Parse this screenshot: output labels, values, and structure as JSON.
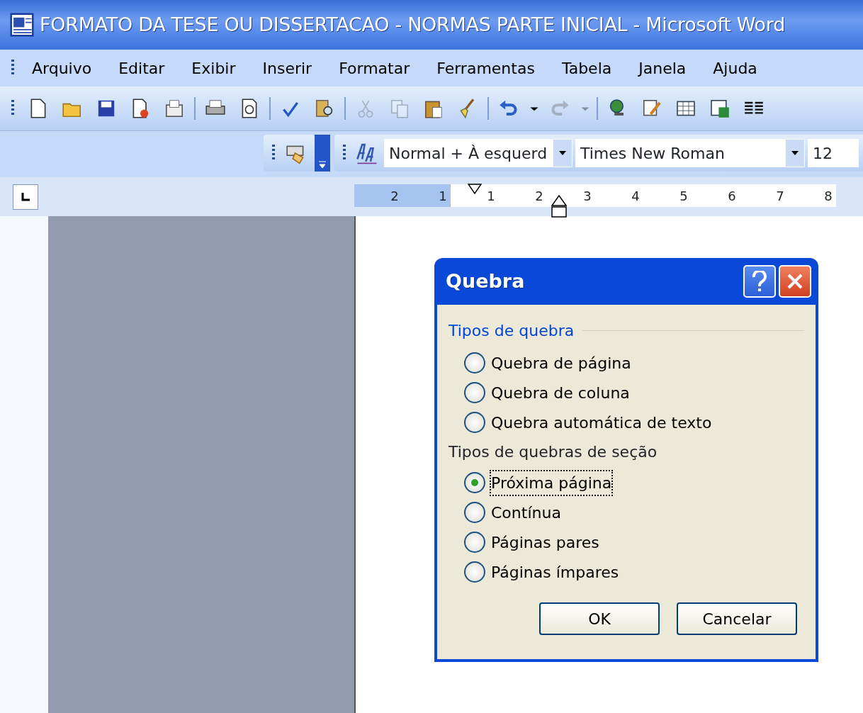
{
  "window": {
    "title": "FORMATO DA TESE OU DISSERTACAO - NORMAS PARTE INICIAL - Microsoft Word"
  },
  "menu": [
    "Arquivo",
    "Editar",
    "Exibir",
    "Inserir",
    "Formatar",
    "Ferramentas",
    "Tabela",
    "Janela",
    "Ajuda"
  ],
  "standard_toolbar": [
    {
      "kind": "new",
      "disabled": false
    },
    {
      "kind": "open",
      "disabled": false
    },
    {
      "kind": "save",
      "disabled": false
    },
    {
      "kind": "permission",
      "disabled": false
    },
    {
      "kind": "email",
      "disabled": false
    },
    {
      "kind": "separator"
    },
    {
      "kind": "print",
      "disabled": false
    },
    {
      "kind": "preview",
      "disabled": false
    },
    {
      "kind": "separator"
    },
    {
      "kind": "spelling",
      "disabled": false
    },
    {
      "kind": "research",
      "disabled": false
    },
    {
      "kind": "separator"
    },
    {
      "kind": "cut",
      "disabled": true
    },
    {
      "kind": "copy",
      "disabled": true
    },
    {
      "kind": "paste",
      "disabled": false
    },
    {
      "kind": "brush",
      "disabled": false
    },
    {
      "kind": "separator"
    },
    {
      "kind": "undo",
      "disabled": false
    },
    {
      "kind": "dropdown",
      "disabled": false
    },
    {
      "kind": "redo",
      "disabled": true
    },
    {
      "kind": "dropdown",
      "disabled": true
    },
    {
      "kind": "separator"
    },
    {
      "kind": "globe",
      "disabled": false
    },
    {
      "kind": "draw",
      "disabled": false
    },
    {
      "kind": "table",
      "disabled": false
    },
    {
      "kind": "sheet",
      "disabled": false
    },
    {
      "kind": "columns",
      "disabled": false
    }
  ],
  "formatting_toolbar": {
    "style": "Normal + À esquerd",
    "font": "Times New Roman",
    "size": "12"
  },
  "ruler": [
    {
      "label": "2",
      "margin": true
    },
    {
      "label": "1",
      "margin": true
    },
    {
      "label": "1",
      "margin": false
    },
    {
      "label": "2",
      "margin": false
    },
    {
      "label": "3",
      "margin": false
    },
    {
      "label": "4",
      "margin": false
    },
    {
      "label": "5",
      "margin": false
    },
    {
      "label": "6",
      "margin": false
    },
    {
      "label": "7",
      "margin": false
    },
    {
      "label": "8",
      "margin": false
    }
  ],
  "dialog": {
    "title": "Quebra",
    "group_title": "Tipos de quebra",
    "break_options": [
      {
        "label": "Quebra de página",
        "selected": false
      },
      {
        "label": "Quebra de coluna",
        "selected": false
      },
      {
        "label": "Quebra automática de texto",
        "selected": false
      }
    ],
    "section_title": "Tipos de quebras de seção",
    "section_options": [
      {
        "label": "Próxima página",
        "selected": true
      },
      {
        "label": "Contínua",
        "selected": false
      },
      {
        "label": "Páginas pares",
        "selected": false
      },
      {
        "label": "Páginas ímpares",
        "selected": false
      }
    ],
    "buttons": [
      "OK",
      "Cancelar"
    ]
  }
}
